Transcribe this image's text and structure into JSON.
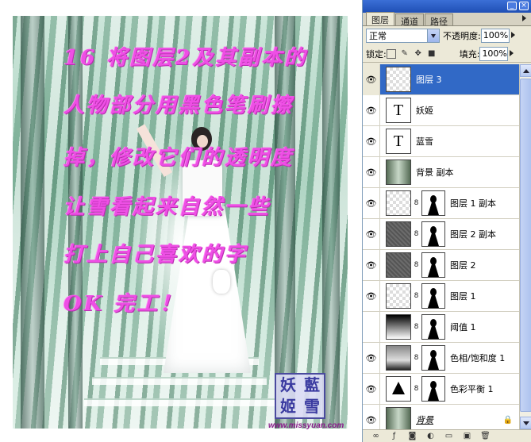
{
  "canvas": {
    "overlay_lines": [
      "16 将图层2及其副本的",
      "人物部分用黑色笔刷擦",
      "掉，修改它们的透明度",
      "让雪看起来自然一些",
      "打上自己喜欢的字",
      "OK 完工！"
    ],
    "seal_chars": [
      "妖",
      "藍",
      "姬",
      "雪"
    ],
    "url": "www.missyuan.com"
  },
  "panel": {
    "tabs": [
      "图层",
      "通道",
      "路径"
    ],
    "active_tab": "图层",
    "blend_mode": "正常",
    "opacity_label": "不透明度:",
    "opacity_value": "100%",
    "lock_label": "锁定:",
    "fill_label": "填充:",
    "fill_value": "100%",
    "layers": [
      {
        "name": "图层 3",
        "thumb": "checker",
        "selected": true,
        "visible": true
      },
      {
        "name": "妖姬",
        "thumb": "text",
        "visible": true
      },
      {
        "name": "蓝雪",
        "thumb": "text",
        "visible": true
      },
      {
        "name": "背景 副本",
        "thumb": "photo",
        "visible": true
      },
      {
        "name": "图层 1 副本",
        "thumb": "checker",
        "mask": true,
        "visible": true
      },
      {
        "name": "图层 2 副本",
        "thumb": "noise",
        "mask": true,
        "visible": true
      },
      {
        "name": "图层 2",
        "thumb": "noise",
        "mask": true,
        "visible": true
      },
      {
        "name": "图层 1",
        "thumb": "checker",
        "mask": true,
        "visible": true
      },
      {
        "name": "阈值 1",
        "thumb": "grad",
        "mask": true,
        "mask_white": true,
        "visible": false
      },
      {
        "name": "色相/饱和度 1",
        "thumb": "grad2",
        "mask": true,
        "visible": true
      },
      {
        "name": "色彩平衡 1",
        "thumb": "bal",
        "mask": true,
        "visible": true
      },
      {
        "name": "背景",
        "thumb": "photo",
        "visible": true,
        "locked": true,
        "italic": true
      }
    ],
    "colors": {
      "selection": "#3169c6",
      "title_bar": "#1f4fb5"
    }
  }
}
